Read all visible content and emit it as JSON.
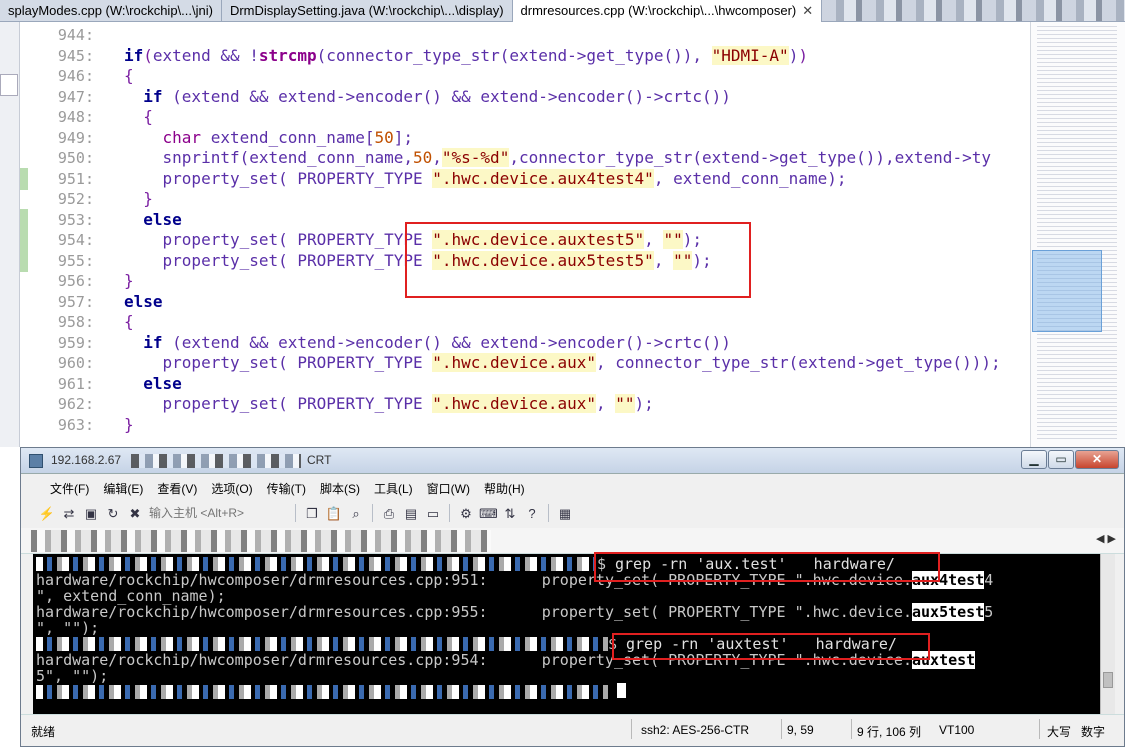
{
  "editor_tabs": [
    {
      "label": "splayModes.cpp (W:\\rockchip\\...\\jni)",
      "active": false
    },
    {
      "label": "DrmDisplaySetting.java (W:\\rockchip\\...\\display)",
      "active": false
    },
    {
      "label": "drmresources.cpp (W:\\rockchip\\...\\hwcomposer)",
      "active": true
    }
  ],
  "close_glyph": "✕",
  "code_lines": [
    {
      "num": "944:",
      "html": ""
    },
    {
      "num": "945:",
      "html": "<span class='kw'>if</span><span class='brace'>(</span>extend &amp;&amp; !<span class='kw' style='color:#8b008b'>strcmp</span>(connector_type_str(extend-&gt;get_type()), <span class='str'>\"HDMI-A\"</span>)<span class='brace'>)</span>"
    },
    {
      "num": "946:",
      "html": "<span class='brace'>{</span>"
    },
    {
      "num": "947:",
      "html": "  <span class='kw'>if</span> (extend &amp;&amp; extend-&gt;encoder() &amp;&amp; extend-&gt;encoder()-&gt;crtc())"
    },
    {
      "num": "948:",
      "html": "  <span class='brace'>{</span>"
    },
    {
      "num": "949:",
      "html": "    <span class='mag'>char</span> extend_conn_name[<span class='num'>50</span>];"
    },
    {
      "num": "950:",
      "html": "    snprintf(extend_conn_name,<span class='num'>50</span>,<span class='str'>\"%s-%d\"</span>,connector_type_str(extend-&gt;get_type()),extend-&gt;ty"
    },
    {
      "num": "951:",
      "html": "    property_set( PROPERTY_TYPE <span class='str'>\".hwc.device.aux4test4\"</span>, extend_conn_name);",
      "gutter": true
    },
    {
      "num": "952:",
      "html": "  <span class='brace'>}</span>"
    },
    {
      "num": "953:",
      "html": "  <span class='kw'>else</span>",
      "gutter": true
    },
    {
      "num": "954:",
      "html": "    property_set( PROPERTY_TYPE <span class='str'>\".hwc.device.auxtest5\"</span>, <span class='str'>\"\"</span>);",
      "gutter": true
    },
    {
      "num": "955:",
      "html": "    property_set( PROPERTY_TYPE <span class='str'>\".hwc.device.aux5test5\"</span>, <span class='str'>\"\"</span>);",
      "gutter": true
    },
    {
      "num": "956:",
      "html": "<span class='brace'>}</span>"
    },
    {
      "num": "957:",
      "html": "<span class='kw'>else</span>"
    },
    {
      "num": "958:",
      "html": "<span class='brace'>{</span>"
    },
    {
      "num": "959:",
      "html": "  <span class='kw'>if</span> (extend &amp;&amp; extend-&gt;encoder() &amp;&amp; extend-&gt;encoder()-&gt;crtc())"
    },
    {
      "num": "960:",
      "html": "    property_set( PROPERTY_TYPE <span class='str'>\".hwc.device.aux\"</span>, connector_type_str(extend-&gt;get_type()));"
    },
    {
      "num": "961:",
      "html": "  <span class='kw'>else</span>"
    },
    {
      "num": "962:",
      "html": "    property_set( PROPERTY_TYPE <span class='str'>\".hwc.device.aux\"</span>, <span class='str'>\"\"</span>);"
    },
    {
      "num": "963:",
      "html": "<span class='brace'>}</span>"
    }
  ],
  "terminal_window": {
    "title_prefix": "192.168.2.67",
    "title_suffix": "CRT",
    "menu": [
      "文件(F)",
      "编辑(E)",
      "查看(V)",
      "选项(O)",
      "传输(T)",
      "脚本(S)",
      "工具(L)",
      "窗口(W)",
      "帮助(H)"
    ],
    "toolbar_icons": [
      "connect-icon",
      "quick-connect-icon",
      "session-icon",
      "reconnect-icon",
      "disconnect-icon"
    ],
    "toolbar_icons_right": [
      "copy-icon",
      "paste-icon",
      "find-icon",
      "print-icon",
      "print-setup-icon",
      "printer-icon",
      "settings-icon",
      "keymap-icon",
      "sftp-icon",
      "help-icon",
      "screen-icon"
    ],
    "host_placeholder": "输入主机 <Alt+R>",
    "min_glyph": "▁",
    "max_glyph": "▭",
    "close_glyph": "✕",
    "scroll_arrows": "◀ ▶"
  },
  "terminal": {
    "lines": [
      {
        "prefix": "$ ",
        "cmd": "grep -rn 'aux.test'   hardware/",
        "blur": true
      },
      {
        "text": "hardware/rockchip/hwcomposer/drmresources.cpp:951:      property_set( PROPERTY_TYPE \".hwc.device.",
        "hl": "aux4test",
        "rest": "4"
      },
      {
        "text": "\", extend_conn_name);"
      },
      {
        "text": "hardware/rockchip/hwcomposer/drmresources.cpp:955:      property_set( PROPERTY_TYPE \".hwc.device.",
        "hl": "aux5test",
        "rest": "5"
      },
      {
        "text": "\", \"\");"
      },
      {
        "prefix": "$ ",
        "cmd": "grep -rn 'auxtest'   hardware/",
        "blur": true
      },
      {
        "text": "hardware/rockchip/hwcomposer/drmresources.cpp:954:      property_set( PROPERTY_TYPE \".hwc.device.",
        "hl": "auxtest",
        "rest": ""
      },
      {
        "text": "5\", \"\");"
      },
      {
        "text": "",
        "blur": true
      }
    ]
  },
  "status": {
    "ready": "就绪",
    "cipher": "ssh2: AES-256-CTR",
    "cursor_pos": "9,  59",
    "rows_cols": "9 行, 106 列",
    "term_type": "VT100",
    "caps": "大写",
    "numlock": "数字"
  }
}
